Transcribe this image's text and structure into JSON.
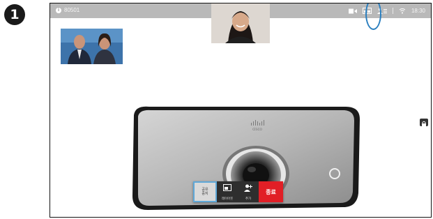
{
  "step_number": "1",
  "status_bar": {
    "call_id": "80501",
    "clock": "18:30",
    "icons": [
      "camera-icon",
      "layout-icon",
      "participants-icon",
      "wifi-icon"
    ]
  },
  "controls": {
    "stop_share_label": "공유\n중지",
    "layout_label": "레이아웃",
    "add_label": "추가",
    "end_label": "종료"
  },
  "device_brand": "cisco",
  "colors": {
    "topbar": "#b9b9b9",
    "highlight": "#2a7fbf",
    "end_call": "#e11f26",
    "active_button_border": "#5fa8d8"
  }
}
